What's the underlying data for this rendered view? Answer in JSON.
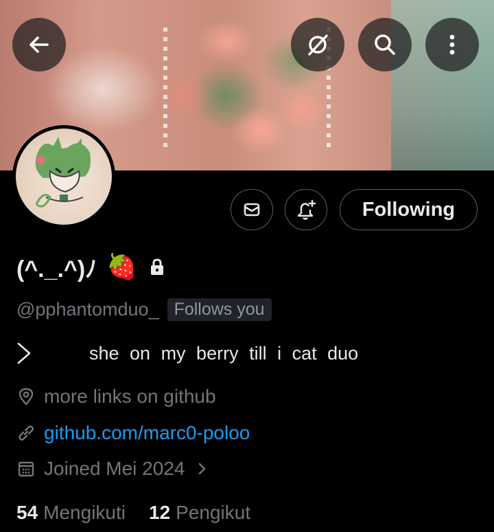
{
  "profile": {
    "display_name": "(^._.^)ﾉ",
    "name_emoji": "🍓",
    "handle": "@pphantomduo_",
    "follows_you_badge": "Follows you",
    "bio": "she on my berry till i cat duo",
    "location": "more links on github",
    "website": "github.com/marc0-poloo",
    "joined": "Joined Mei 2024"
  },
  "actions": {
    "following_label": "Following"
  },
  "stats": {
    "following_count": "54",
    "following_label": "Mengikuti",
    "followers_count": "12",
    "followers_label": "Pengikut"
  },
  "icons": {
    "back": "back-arrow-icon",
    "grok": "grok-icon",
    "search": "search-icon",
    "more": "more-vertical-icon",
    "message": "message-icon",
    "notify": "notification-bell-icon",
    "lock": "lock-icon",
    "bio_expand": "chevron-right-icon",
    "location": "location-pin-icon",
    "link": "link-icon",
    "calendar": "calendar-icon",
    "joined_expand": "chevron-right-icon"
  },
  "colors": {
    "background": "#000000",
    "text": "#e7e9ea",
    "secondary": "#71767b",
    "link": "#1d9bf0",
    "border": "#536471"
  }
}
